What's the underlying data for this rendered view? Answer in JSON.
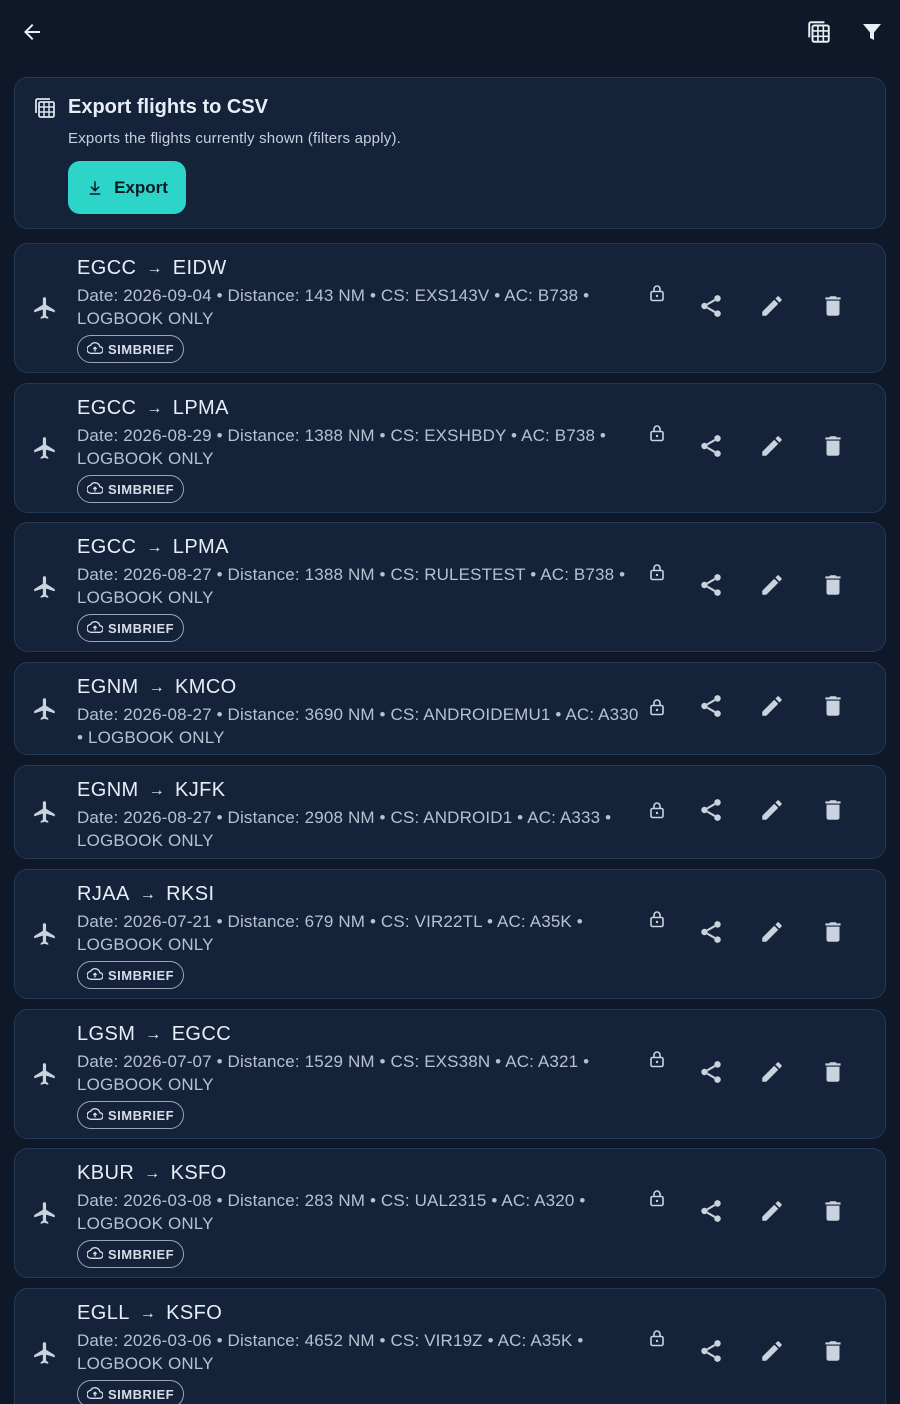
{
  "header": {
    "back_icon": "arrow-left-icon",
    "csv_icon": "table-icon",
    "filter_icon": "filter-icon"
  },
  "export": {
    "title": "Export flights to CSV",
    "subtitle": "Exports the flights currently shown (filters apply).",
    "button_label": "Export"
  },
  "colors": {
    "background": "#0f1828",
    "card": "#14223a",
    "card_border": "#253a55",
    "accent": "#2dd4c8"
  },
  "flights": [
    {
      "from": "EGCC",
      "to": "EIDW",
      "details": "Date: 2026-09-04 • Distance: 143 NM • CS: EXS143V • AC: B738 • LOGBOOK ONLY",
      "badge": "SIMBRIEF"
    },
    {
      "from": "EGCC",
      "to": "LPMA",
      "details": "Date: 2026-08-29 • Distance: 1388 NM • CS: EXSHBDY • AC: B738 • LOGBOOK ONLY",
      "badge": "SIMBRIEF"
    },
    {
      "from": "EGCC",
      "to": "LPMA",
      "details": "Date: 2026-08-27 • Distance: 1388 NM • CS: RULESTEST • AC: B738 • LOGBOOK ONLY",
      "badge": "SIMBRIEF"
    },
    {
      "from": "EGNM",
      "to": "KMCO",
      "details": "Date: 2026-08-27 • Distance: 3690 NM • CS: ANDROIDEMU1 • AC: A330 • LOGBOOK ONLY",
      "badge": ""
    },
    {
      "from": "EGNM",
      "to": "KJFK",
      "details": "Date: 2026-08-27 • Distance: 2908 NM • CS: ANDROID1 • AC: A333 • LOGBOOK ONLY",
      "badge": ""
    },
    {
      "from": "RJAA",
      "to": "RKSI",
      "details": "Date: 2026-07-21 • Distance: 679 NM • CS: VIR22TL • AC: A35K • LOGBOOK ONLY",
      "badge": "SIMBRIEF"
    },
    {
      "from": "LGSM",
      "to": "EGCC",
      "details": "Date: 2026-07-07 • Distance: 1529 NM • CS: EXS38N • AC: A321 • LOGBOOK ONLY",
      "badge": "SIMBRIEF"
    },
    {
      "from": "KBUR",
      "to": "KSFO",
      "details": "Date: 2026-03-08 • Distance: 283 NM • CS: UAL2315 • AC: A320 • LOGBOOK ONLY",
      "badge": "SIMBRIEF"
    },
    {
      "from": "EGLL",
      "to": "KSFO",
      "details": "Date: 2026-03-06 • Distance: 4652 NM • CS: VIR19Z • AC: A35K • LOGBOOK ONLY",
      "badge": "SIMBRIEF"
    }
  ]
}
